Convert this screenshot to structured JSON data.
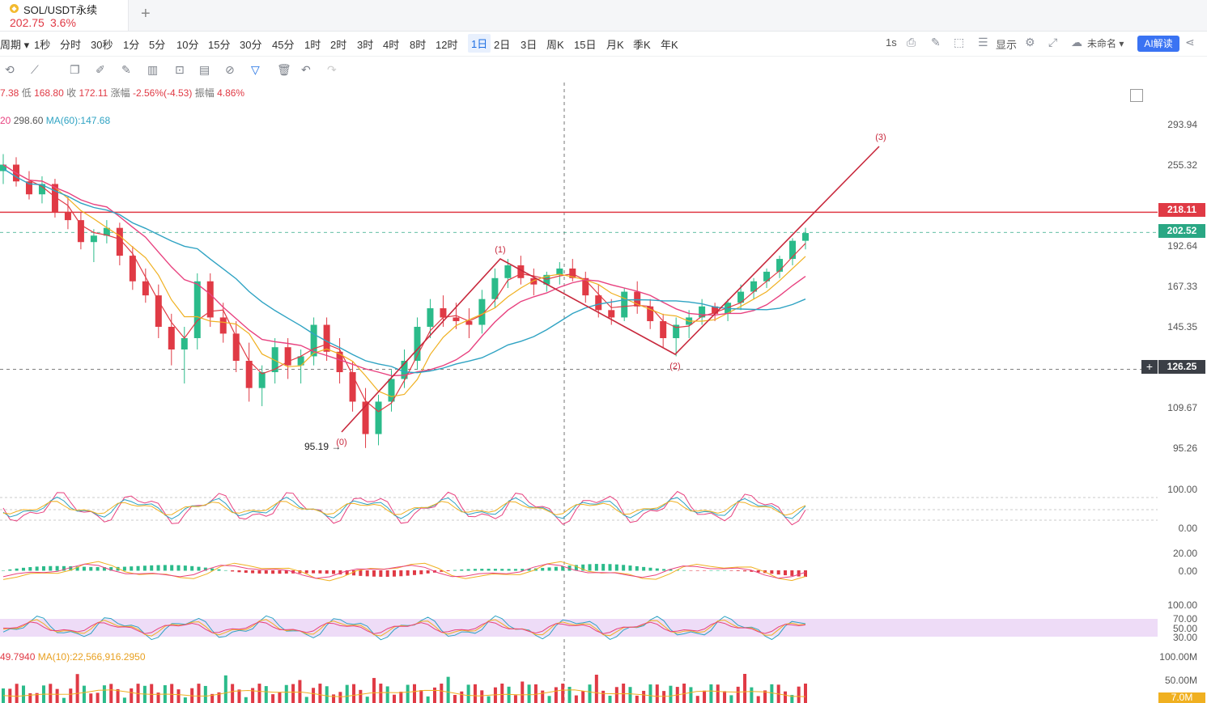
{
  "tab": {
    "symbol": "SOL/USDT永续",
    "price": "202.75",
    "change": "3.6%",
    "coin_icon": "sol-coin-icon",
    "add_icon": "+"
  },
  "toolbar": {
    "period_label": "周期",
    "timeframes": [
      "1秒",
      "分时",
      "30秒",
      "1分",
      "5分",
      "10分",
      "15分",
      "30分",
      "45分",
      "1时",
      "2时",
      "3时",
      "4时",
      "8时",
      "12时",
      "1日",
      "2日",
      "3日",
      "周K",
      "15日",
      "月K",
      "季K",
      "年K"
    ],
    "active_timeframe": "1日",
    "interval": "1s",
    "display_label": "显示",
    "layout_name": "未命名",
    "ai_label": "AI解读"
  },
  "ohlc": {
    "open_fragment": "7.38",
    "low_label": "低",
    "low": "168.80",
    "close_label": "收",
    "close": "172.11",
    "chg_label": "涨幅",
    "chg": "-2.56%(-4.53)",
    "amp_label": "振幅",
    "amp": "4.86%"
  },
  "ma_info": {
    "text1": "20",
    "text2": "298.60",
    "text3": "MA(60):147.68"
  },
  "vol_info": {
    "left": "49.7940",
    "ma10": "MA(10):22,566,916.2950"
  },
  "colors": {
    "up": "#2bbb8a",
    "down": "#e03a45",
    "ma1": "#e8417f",
    "ma2": "#f0b020",
    "ma3": "#2fa3c3",
    "wave": "#c8283c",
    "resistance": "#e03a45",
    "accent": "#1e6fe3"
  },
  "price_axis": [
    "293.94",
    "255.32",
    "192.64",
    "167.33",
    "145.35",
    "109.67",
    "95.26"
  ],
  "osc_axis": [
    "100.00",
    "0.00"
  ],
  "macd_axis": [
    "20.00",
    "0.00"
  ],
  "rsi_axis": [
    "100.00",
    "70.00",
    "50.00",
    "30.00"
  ],
  "vol_axis": [
    "100.00M",
    "50.00M",
    "7.0M"
  ],
  "price_tags": {
    "resistance": "218.11",
    "current": "202.52",
    "crosshair": "126.25"
  },
  "annotations": {
    "low_label": "95.19",
    "wave0": "(0)",
    "wave1": "(1)",
    "wave2": "(2)",
    "wave3": "(3)"
  },
  "chart_data": {
    "type": "candlestick",
    "symbol": "SOL/USDT",
    "series_ohlc_approx": [
      [
        250,
        265,
        240,
        255
      ],
      [
        255,
        262,
        238,
        242
      ],
      [
        242,
        250,
        228,
        232
      ],
      [
        232,
        246,
        225,
        240
      ],
      [
        240,
        244,
        214,
        218
      ],
      [
        218,
        230,
        205,
        212
      ],
      [
        212,
        218,
        190,
        195
      ],
      [
        195,
        205,
        182,
        200
      ],
      [
        200,
        212,
        194,
        206
      ],
      [
        206,
        210,
        180,
        186
      ],
      [
        186,
        192,
        165,
        170
      ],
      [
        170,
        178,
        158,
        162
      ],
      [
        162,
        168,
        140,
        145
      ],
      [
        145,
        152,
        128,
        135
      ],
      [
        135,
        145,
        120,
        140
      ],
      [
        140,
        175,
        135,
        170
      ],
      [
        170,
        175,
        145,
        150
      ],
      [
        150,
        158,
        138,
        142
      ],
      [
        142,
        148,
        125,
        130
      ],
      [
        130,
        138,
        112,
        118
      ],
      [
        118,
        128,
        110,
        125
      ],
      [
        125,
        140,
        120,
        136
      ],
      [
        136,
        140,
        122,
        128
      ],
      [
        128,
        135,
        120,
        132
      ],
      [
        132,
        150,
        128,
        146
      ],
      [
        146,
        150,
        130,
        134
      ],
      [
        134,
        140,
        120,
        125
      ],
      [
        125,
        130,
        108,
        112
      ],
      [
        112,
        118,
        95,
        100
      ],
      [
        100,
        115,
        96,
        112
      ],
      [
        112,
        126,
        108,
        122
      ],
      [
        122,
        135,
        118,
        130
      ],
      [
        130,
        150,
        126,
        145
      ],
      [
        145,
        160,
        140,
        155
      ],
      [
        155,
        162,
        145,
        150
      ],
      [
        150,
        158,
        144,
        148
      ],
      [
        148,
        155,
        140,
        146
      ],
      [
        146,
        165,
        142,
        160
      ],
      [
        160,
        178,
        155,
        172
      ],
      [
        172,
        184,
        166,
        180
      ],
      [
        180,
        186,
        168,
        172
      ],
      [
        172,
        178,
        162,
        168
      ],
      [
        168,
        176,
        164,
        174
      ],
      [
        174,
        182,
        168,
        178
      ],
      [
        178,
        184,
        170,
        172
      ],
      [
        172,
        176,
        158,
        162
      ],
      [
        162,
        168,
        150,
        154
      ],
      [
        154,
        160,
        146,
        150
      ],
      [
        150,
        166,
        148,
        164
      ],
      [
        164,
        170,
        152,
        156
      ],
      [
        156,
        160,
        144,
        148
      ],
      [
        148,
        152,
        136,
        140
      ],
      [
        140,
        150,
        132,
        146
      ],
      [
        146,
        154,
        140,
        150
      ],
      [
        150,
        160,
        146,
        156
      ],
      [
        156,
        158,
        148,
        152
      ],
      [
        152,
        160,
        148,
        158
      ],
      [
        158,
        168,
        154,
        164
      ],
      [
        164,
        172,
        160,
        170
      ],
      [
        170,
        178,
        166,
        176
      ],
      [
        176,
        186,
        172,
        184
      ],
      [
        184,
        198,
        180,
        196
      ],
      [
        196,
        206,
        190,
        202
      ]
    ],
    "ma_lines": [
      "MA fast",
      "MA mid",
      "MA(60)"
    ],
    "ma60_value": 147.68,
    "resistance_level": 218.11,
    "current_level": 202.52,
    "crosshair_level": 126.25,
    "swing_low": 95.19,
    "elliott_waves": [
      "(0)",
      "(1)",
      "(2)",
      "(3)"
    ],
    "ylim": [
      90,
      300
    ]
  }
}
